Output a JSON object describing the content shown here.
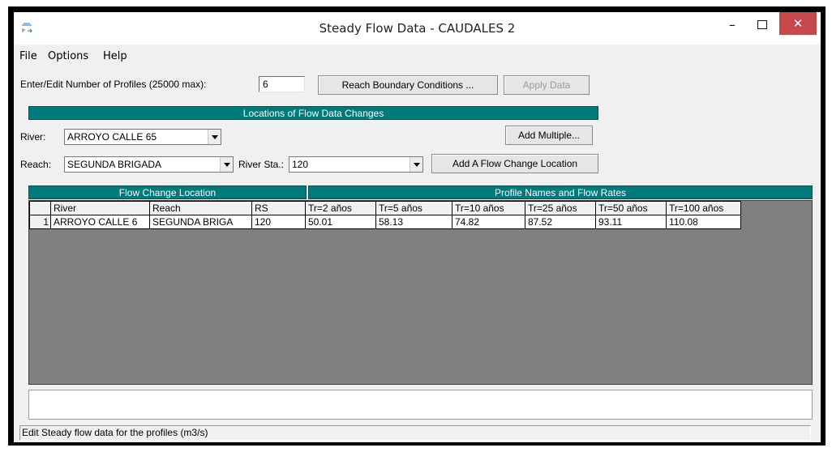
{
  "window": {
    "title": "Steady Flow Data - CAUDALES 2",
    "close_glyph": "✕",
    "min_glyph": "–"
  },
  "menu": [
    "File",
    "Options",
    "Help"
  ],
  "profiles": {
    "label": "Enter/Edit Number of Profiles (25000 max):",
    "value": "6"
  },
  "buttons": {
    "reach_boundary": "Reach Boundary Conditions ...",
    "apply_data": "Apply Data",
    "add_multiple": "Add Multiple...",
    "add_flow_change": "Add A Flow Change Location"
  },
  "locations_header": "Locations of Flow Data Changes",
  "river": {
    "label": "River:",
    "value": "ARROYO CALLE 65"
  },
  "reach": {
    "label": "Reach:",
    "value": "SEGUNDA BRIGADA"
  },
  "river_sta": {
    "label": "River Sta.:",
    "value": "120"
  },
  "grid": {
    "left_header": "Flow Change Location",
    "right_header": "Profile Names and Flow Rates",
    "columns": [
      "River",
      "Reach",
      "RS",
      "Tr=2 años",
      "Tr=5 años",
      "Tr=10 años",
      "Tr=25 años",
      "Tr=50 años",
      "Tr=100 años"
    ],
    "rows": [
      {
        "num": "1",
        "cells": [
          "ARROYO CALLE 6",
          "SEGUNDA BRIGA",
          "120",
          "50.01",
          "58.13",
          "74.82",
          "87.52",
          "93.11",
          "110.08"
        ]
      }
    ]
  },
  "description": "",
  "status": "Edit Steady flow data for the profiles (m3/s)",
  "colors": {
    "teal_header": "#007a7a",
    "grid_background": "#808080",
    "close_button": "#c7484a"
  }
}
